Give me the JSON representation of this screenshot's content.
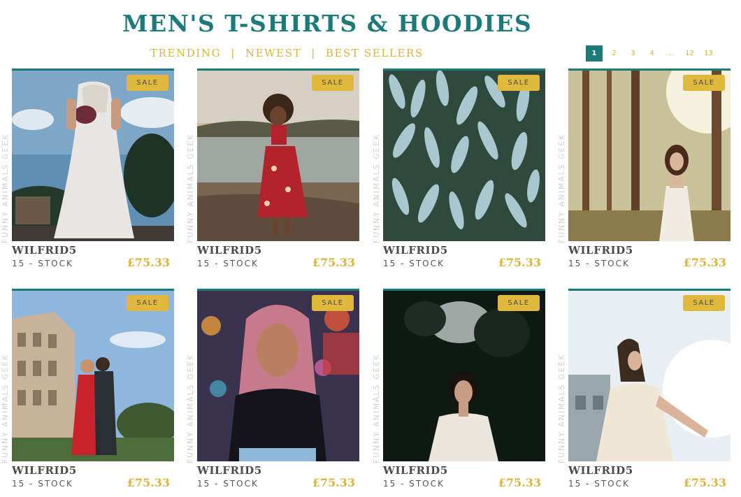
{
  "header": {
    "title": "MEN'S T-SHIRTS & HOODIES",
    "filters": [
      "TRENDING",
      "NEWEST",
      "BEST SELLERS"
    ],
    "filter_separator": "|"
  },
  "pagination": {
    "pages": [
      "1",
      "2",
      "3",
      "4",
      "...",
      "12",
      "13"
    ],
    "current": "1"
  },
  "products": [
    {
      "badge": "SALE",
      "side_label": "FUNNY ANIMALS GEEK",
      "name": "WILFRID5",
      "stock": "15 - STOCK",
      "price": "£75.33",
      "image": "bride-in-white-dress"
    },
    {
      "badge": "SALE",
      "side_label": "FUNNY ANIMALS GEEK",
      "name": "WILFRID5",
      "stock": "15 - STOCK",
      "price": "£75.33",
      "image": "woman-in-red-floral-dress-by-lake"
    },
    {
      "badge": "SALE",
      "side_label": "FUNNY ANIMALS GEEK",
      "name": "WILFRID5",
      "stock": "15 - STOCK",
      "price": "£75.33",
      "image": "succulent-plants"
    },
    {
      "badge": "SALE",
      "side_label": "FUNNY ANIMALS GEEK",
      "name": "WILFRID5",
      "stock": "15 - STOCK",
      "price": "£75.33",
      "image": "woman-in-forest-sunlight"
    },
    {
      "badge": "SALE",
      "side_label": "FUNNY ANIMALS GEEK",
      "name": "WILFRID5",
      "stock": "15 - STOCK",
      "price": "£75.33",
      "image": "couple-at-colosseum"
    },
    {
      "badge": "SALE",
      "side_label": "FUNNY ANIMALS GEEK",
      "name": "WILFRID5",
      "stock": "15 - STOCK",
      "price": "£75.33",
      "image": "woman-with-pink-hair-city-lights"
    },
    {
      "badge": "SALE",
      "side_label": "FUNNY ANIMALS GEEK",
      "name": "WILFRID5",
      "stock": "15 - STOCK",
      "price": "£75.33",
      "image": "woman-in-dark-forest"
    },
    {
      "badge": "SALE",
      "side_label": "FUNNY ANIMALS GEEK",
      "name": "WILFRID5",
      "stock": "15 - STOCK",
      "price": "£75.33",
      "image": "woman-in-sunlight-white-dress"
    }
  ],
  "colors": {
    "title": "#1d7a7a",
    "accent": "#d9b43a",
    "badge": "#e0b93c",
    "text_dark": "#4a4a4a"
  }
}
